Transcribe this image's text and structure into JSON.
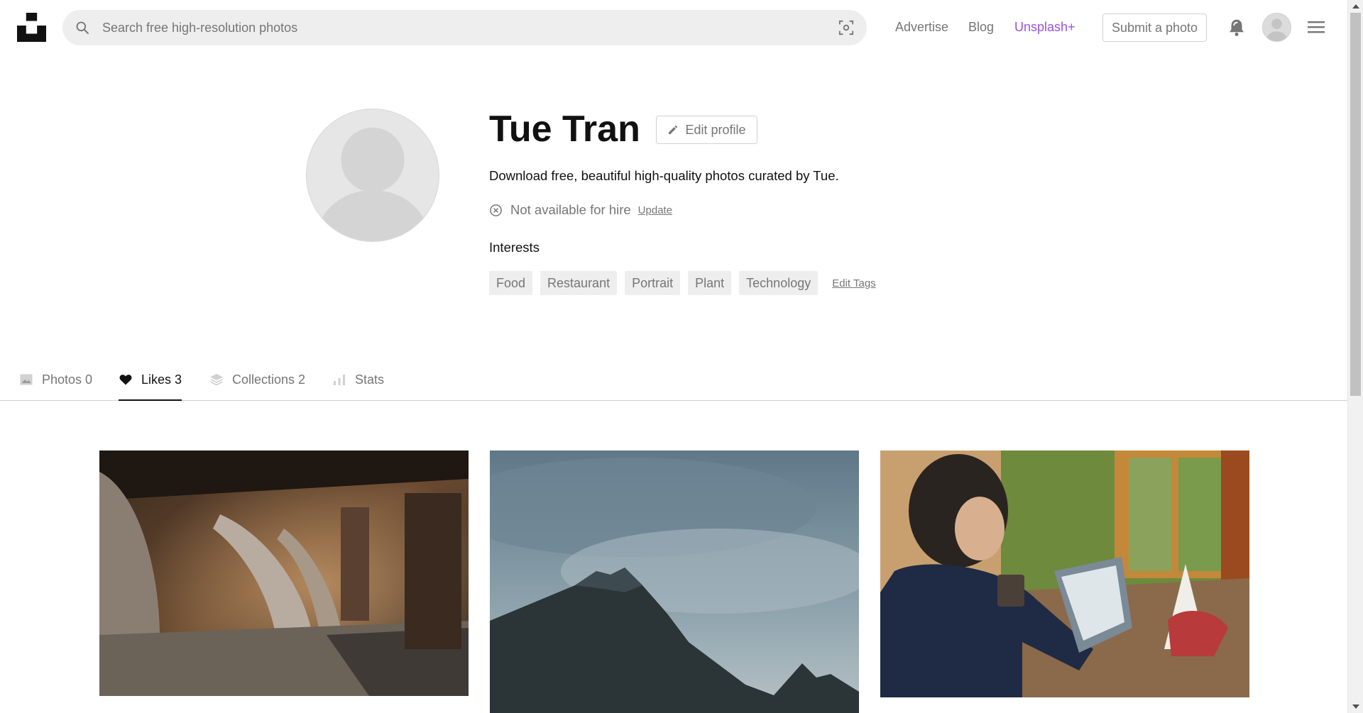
{
  "header": {
    "search_placeholder": "Search free high-resolution photos",
    "nav": {
      "advertise": "Advertise",
      "blog": "Blog",
      "unsplash_plus": "Unsplash+"
    },
    "submit_label": "Submit a photo",
    "icons": [
      "logo-icon",
      "search-icon",
      "visual-search-icon",
      "bell-icon",
      "menu-icon"
    ]
  },
  "profile": {
    "name": "Tue Tran",
    "edit_label": "Edit profile",
    "bio": "Download free, beautiful high-quality photos curated by Tue.",
    "hire_status": "Not available for hire",
    "update_label": "Update",
    "interests_title": "Interests",
    "tags": [
      "Food",
      "Restaurant",
      "Portrait",
      "Plant",
      "Technology"
    ],
    "edit_tags_label": "Edit Tags"
  },
  "tabs": [
    {
      "label": "Photos 0",
      "icon": "image-icon",
      "active": false
    },
    {
      "label": "Likes 3",
      "icon": "heart-icon",
      "active": true
    },
    {
      "label": "Collections 2",
      "icon": "layers-icon",
      "active": false
    },
    {
      "label": "Stats",
      "icon": "bar-chart-icon",
      "active": false
    }
  ],
  "colors": {
    "accent_plus": "#9b51e0",
    "muted_text": "#767676",
    "search_bg": "#eeeeee"
  }
}
